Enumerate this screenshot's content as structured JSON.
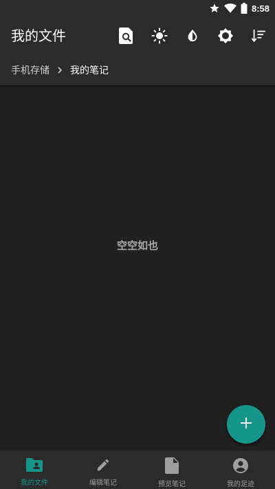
{
  "status_bar": {
    "time": "8:58",
    "icons": [
      "star-icon",
      "wifi-icon",
      "battery-icon"
    ]
  },
  "app_bar": {
    "title": "我的文件",
    "actions": [
      "file-search-icon",
      "brightness-icon",
      "contrast-icon",
      "settings-brightness-icon",
      "sort-icon"
    ]
  },
  "breadcrumb": {
    "root": "手机存储",
    "current": "我的笔记",
    "separator_icon": "chevron-right-icon"
  },
  "content": {
    "empty_text": "空空如也"
  },
  "fab": {
    "icon": "plus-icon"
  },
  "bottom_nav": {
    "items": [
      {
        "label": "我的文件",
        "icon": "folder-account-icon",
        "active": true
      },
      {
        "label": "编辑笔记",
        "icon": "pencil-icon",
        "active": false
      },
      {
        "label": "预览笔记",
        "icon": "document-icon",
        "active": false
      },
      {
        "label": "我的足迹",
        "icon": "account-circle-icon",
        "active": false
      }
    ]
  },
  "colors": {
    "accent": "#169688",
    "background": "#212121",
    "bar": "#2b2b2b",
    "inactive": "#9e9e9e"
  }
}
